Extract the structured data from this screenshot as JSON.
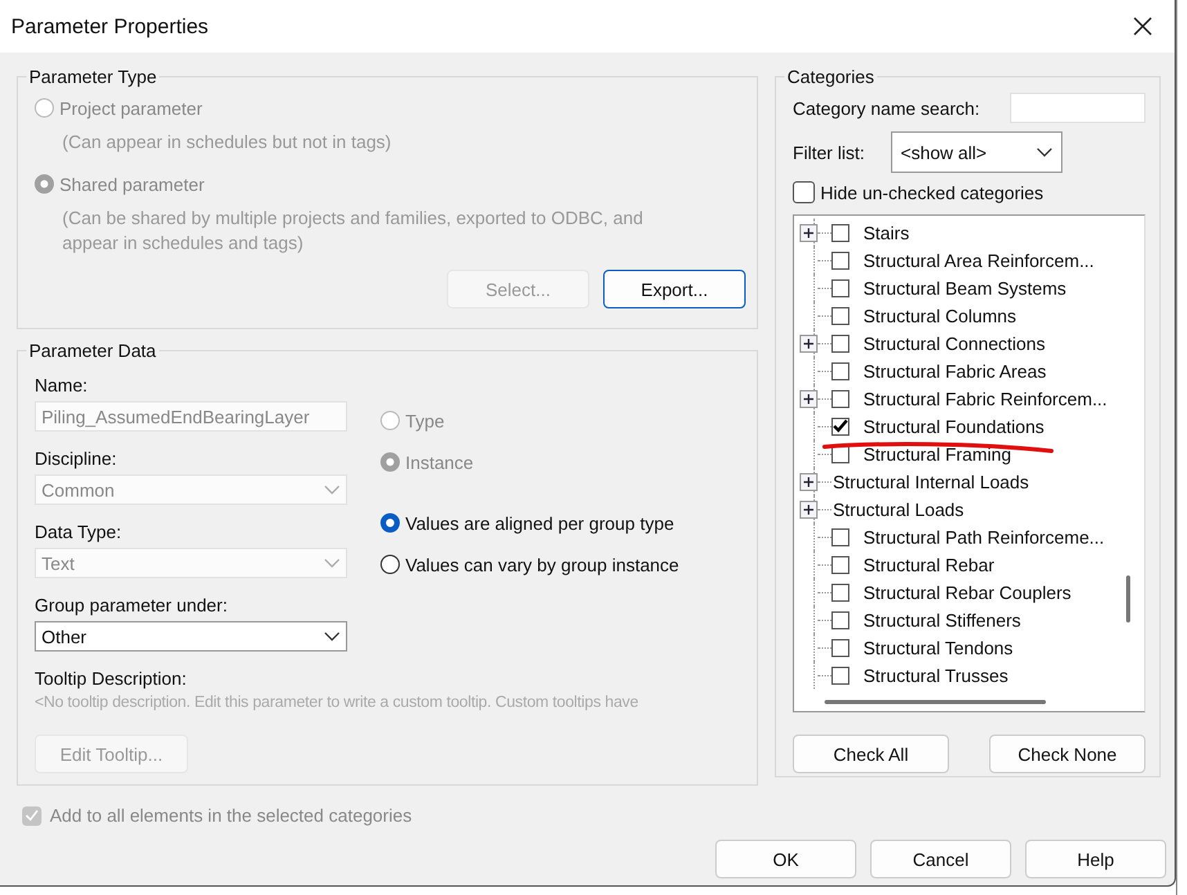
{
  "window": {
    "title": "Parameter Properties"
  },
  "parameter_type": {
    "title": "Parameter Type",
    "disabled": true,
    "options": [
      {
        "label": "Project parameter",
        "note": "(Can appear in schedules but not in tags)",
        "selected": false
      },
      {
        "label": "Shared parameter",
        "note": "(Can be shared by multiple projects and families, exported to ODBC, and appear in schedules and tags)",
        "selected": true
      }
    ],
    "buttons": [
      {
        "label": "Select...",
        "disabled": true
      },
      {
        "label": "Export...",
        "disabled": false
      }
    ]
  },
  "parameter_data": {
    "title": "Parameter Data",
    "name": {
      "label": "Name:",
      "value": "Piling_AssumedEndBearingLayer",
      "disabled": true
    },
    "discipline": {
      "label": "Discipline:",
      "value": "Common",
      "disabled": true
    },
    "data_type": {
      "label": "Data Type:",
      "value": "Text",
      "disabled": true
    },
    "group_under": {
      "label": "Group parameter under:",
      "value": "Other",
      "disabled": false
    },
    "scope_options": [
      {
        "label": "Type",
        "selected": false,
        "disabled": true
      },
      {
        "label": "Instance",
        "selected": true,
        "disabled": true
      }
    ],
    "group_options": [
      {
        "label": "Values are aligned per group type",
        "selected": true,
        "disabled": false
      },
      {
        "label": "Values can vary by group instance",
        "selected": false,
        "disabled": false
      }
    ],
    "tooltip": {
      "label": "Tooltip Description:",
      "text": "<No tooltip description. Edit this parameter to write a custom tooltip. Custom tooltips have"
    },
    "edit_tooltip": {
      "label": "Edit Tooltip...",
      "disabled": true
    }
  },
  "add_to_all": {
    "label": "Add to all elements in the selected categories",
    "checked": true,
    "disabled": true
  },
  "categories": {
    "title": "Categories",
    "search_label": "Category name search:",
    "filter_label": "Filter list:",
    "filter_value": "<show all>",
    "hide_unchecked": {
      "label": "Hide un-checked categories",
      "checked": false
    },
    "items": [
      {
        "label": "Stairs",
        "kind": "checkbox",
        "expandable": true,
        "checked": false
      },
      {
        "label": "Structural Area Reinforcem...",
        "kind": "checkbox",
        "expandable": false,
        "checked": false
      },
      {
        "label": "Structural Beam Systems",
        "kind": "checkbox",
        "expandable": false,
        "checked": false
      },
      {
        "label": "Structural Columns",
        "kind": "checkbox",
        "expandable": false,
        "checked": false
      },
      {
        "label": "Structural Connections",
        "kind": "checkbox",
        "expandable": true,
        "checked": false
      },
      {
        "label": "Structural Fabric Areas",
        "kind": "checkbox",
        "expandable": false,
        "checked": false
      },
      {
        "label": "Structural Fabric Reinforcem...",
        "kind": "checkbox",
        "expandable": true,
        "checked": false
      },
      {
        "label": "Structural Foundations",
        "kind": "checkbox",
        "expandable": false,
        "checked": true
      },
      {
        "label": "Structural Framing",
        "kind": "checkbox",
        "expandable": false,
        "checked": false
      },
      {
        "label": "Structural Internal Loads",
        "kind": "group",
        "expandable": true
      },
      {
        "label": "Structural Loads",
        "kind": "group",
        "expandable": true
      },
      {
        "label": "Structural Path Reinforceme...",
        "kind": "checkbox",
        "expandable": false,
        "checked": false
      },
      {
        "label": "Structural Rebar",
        "kind": "checkbox",
        "expandable": false,
        "checked": false
      },
      {
        "label": "Structural Rebar Couplers",
        "kind": "checkbox",
        "expandable": false,
        "checked": false
      },
      {
        "label": "Structural Stiffeners",
        "kind": "checkbox",
        "expandable": false,
        "checked": false
      },
      {
        "label": "Structural Tendons",
        "kind": "checkbox",
        "expandable": false,
        "checked": false
      },
      {
        "label": "Structural Trusses",
        "kind": "checkbox",
        "expandable": false,
        "checked": false
      }
    ],
    "buttons": [
      "Check All",
      "Check None"
    ]
  },
  "footer_buttons": [
    {
      "label": "OK",
      "selected": false
    },
    {
      "label": "Cancel",
      "selected": false
    },
    {
      "label": "Help",
      "selected": false
    }
  ]
}
